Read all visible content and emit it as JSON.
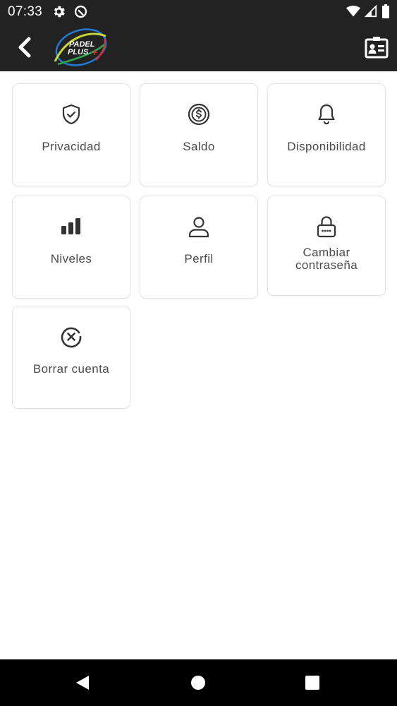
{
  "status_bar": {
    "time": "07:33",
    "left_icons": [
      "gear-icon",
      "data-saver-icon"
    ],
    "right_icons": [
      "wifi-icon",
      "signal-icon",
      "battery-icon"
    ]
  },
  "app_bar": {
    "logo_text_line1": "PADEL",
    "logo_text_line2": "PLUS",
    "back_icon": "chevron-left-icon",
    "action_icon": "contact-card-icon"
  },
  "menu": {
    "items": [
      {
        "label": "Privacidad",
        "icon": "shield-check-icon"
      },
      {
        "label": "Saldo",
        "icon": "dollar-coin-icon"
      },
      {
        "label": "Disponibilidad",
        "icon": "bell-icon"
      },
      {
        "label": "Niveles",
        "icon": "bar-levels-icon"
      },
      {
        "label": "Perfil",
        "icon": "user-icon"
      },
      {
        "label": "Cambiar contraseña",
        "icon": "lock-icon"
      },
      {
        "label": "Borrar cuenta",
        "icon": "close-circle-icon"
      }
    ]
  },
  "nav_bar": {
    "buttons": [
      "back-triangle-icon",
      "home-circle-icon",
      "recents-square-icon"
    ]
  },
  "colors": {
    "bar_background": "#222222",
    "tile_border": "#e4e4e4",
    "label_text": "#4a4a4a",
    "icon_stroke": "#333333"
  }
}
